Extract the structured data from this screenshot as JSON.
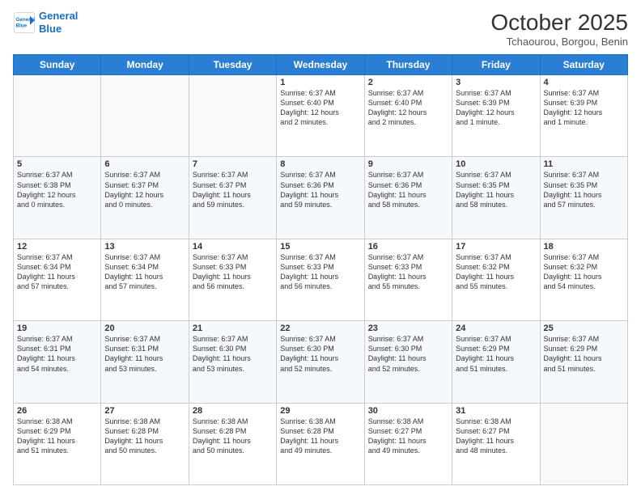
{
  "logo": {
    "line1": "General",
    "line2": "Blue"
  },
  "title": "October 2025",
  "location": "Tchaourou, Borgou, Benin",
  "days_of_week": [
    "Sunday",
    "Monday",
    "Tuesday",
    "Wednesday",
    "Thursday",
    "Friday",
    "Saturday"
  ],
  "weeks": [
    [
      {
        "day": "",
        "info": ""
      },
      {
        "day": "",
        "info": ""
      },
      {
        "day": "",
        "info": ""
      },
      {
        "day": "1",
        "info": "Sunrise: 6:37 AM\nSunset: 6:40 PM\nDaylight: 12 hours\nand 2 minutes."
      },
      {
        "day": "2",
        "info": "Sunrise: 6:37 AM\nSunset: 6:40 PM\nDaylight: 12 hours\nand 2 minutes."
      },
      {
        "day": "3",
        "info": "Sunrise: 6:37 AM\nSunset: 6:39 PM\nDaylight: 12 hours\nand 1 minute."
      },
      {
        "day": "4",
        "info": "Sunrise: 6:37 AM\nSunset: 6:39 PM\nDaylight: 12 hours\nand 1 minute."
      }
    ],
    [
      {
        "day": "5",
        "info": "Sunrise: 6:37 AM\nSunset: 6:38 PM\nDaylight: 12 hours\nand 0 minutes."
      },
      {
        "day": "6",
        "info": "Sunrise: 6:37 AM\nSunset: 6:37 PM\nDaylight: 12 hours\nand 0 minutes."
      },
      {
        "day": "7",
        "info": "Sunrise: 6:37 AM\nSunset: 6:37 PM\nDaylight: 11 hours\nand 59 minutes."
      },
      {
        "day": "8",
        "info": "Sunrise: 6:37 AM\nSunset: 6:36 PM\nDaylight: 11 hours\nand 59 minutes."
      },
      {
        "day": "9",
        "info": "Sunrise: 6:37 AM\nSunset: 6:36 PM\nDaylight: 11 hours\nand 58 minutes."
      },
      {
        "day": "10",
        "info": "Sunrise: 6:37 AM\nSunset: 6:35 PM\nDaylight: 11 hours\nand 58 minutes."
      },
      {
        "day": "11",
        "info": "Sunrise: 6:37 AM\nSunset: 6:35 PM\nDaylight: 11 hours\nand 57 minutes."
      }
    ],
    [
      {
        "day": "12",
        "info": "Sunrise: 6:37 AM\nSunset: 6:34 PM\nDaylight: 11 hours\nand 57 minutes."
      },
      {
        "day": "13",
        "info": "Sunrise: 6:37 AM\nSunset: 6:34 PM\nDaylight: 11 hours\nand 57 minutes."
      },
      {
        "day": "14",
        "info": "Sunrise: 6:37 AM\nSunset: 6:33 PM\nDaylight: 11 hours\nand 56 minutes."
      },
      {
        "day": "15",
        "info": "Sunrise: 6:37 AM\nSunset: 6:33 PM\nDaylight: 11 hours\nand 56 minutes."
      },
      {
        "day": "16",
        "info": "Sunrise: 6:37 AM\nSunset: 6:33 PM\nDaylight: 11 hours\nand 55 minutes."
      },
      {
        "day": "17",
        "info": "Sunrise: 6:37 AM\nSunset: 6:32 PM\nDaylight: 11 hours\nand 55 minutes."
      },
      {
        "day": "18",
        "info": "Sunrise: 6:37 AM\nSunset: 6:32 PM\nDaylight: 11 hours\nand 54 minutes."
      }
    ],
    [
      {
        "day": "19",
        "info": "Sunrise: 6:37 AM\nSunset: 6:31 PM\nDaylight: 11 hours\nand 54 minutes."
      },
      {
        "day": "20",
        "info": "Sunrise: 6:37 AM\nSunset: 6:31 PM\nDaylight: 11 hours\nand 53 minutes."
      },
      {
        "day": "21",
        "info": "Sunrise: 6:37 AM\nSunset: 6:30 PM\nDaylight: 11 hours\nand 53 minutes."
      },
      {
        "day": "22",
        "info": "Sunrise: 6:37 AM\nSunset: 6:30 PM\nDaylight: 11 hours\nand 52 minutes."
      },
      {
        "day": "23",
        "info": "Sunrise: 6:37 AM\nSunset: 6:30 PM\nDaylight: 11 hours\nand 52 minutes."
      },
      {
        "day": "24",
        "info": "Sunrise: 6:37 AM\nSunset: 6:29 PM\nDaylight: 11 hours\nand 51 minutes."
      },
      {
        "day": "25",
        "info": "Sunrise: 6:37 AM\nSunset: 6:29 PM\nDaylight: 11 hours\nand 51 minutes."
      }
    ],
    [
      {
        "day": "26",
        "info": "Sunrise: 6:38 AM\nSunset: 6:29 PM\nDaylight: 11 hours\nand 51 minutes."
      },
      {
        "day": "27",
        "info": "Sunrise: 6:38 AM\nSunset: 6:28 PM\nDaylight: 11 hours\nand 50 minutes."
      },
      {
        "day": "28",
        "info": "Sunrise: 6:38 AM\nSunset: 6:28 PM\nDaylight: 11 hours\nand 50 minutes."
      },
      {
        "day": "29",
        "info": "Sunrise: 6:38 AM\nSunset: 6:28 PM\nDaylight: 11 hours\nand 49 minutes."
      },
      {
        "day": "30",
        "info": "Sunrise: 6:38 AM\nSunset: 6:27 PM\nDaylight: 11 hours\nand 49 minutes."
      },
      {
        "day": "31",
        "info": "Sunrise: 6:38 AM\nSunset: 6:27 PM\nDaylight: 11 hours\nand 48 minutes."
      },
      {
        "day": "",
        "info": ""
      }
    ]
  ]
}
